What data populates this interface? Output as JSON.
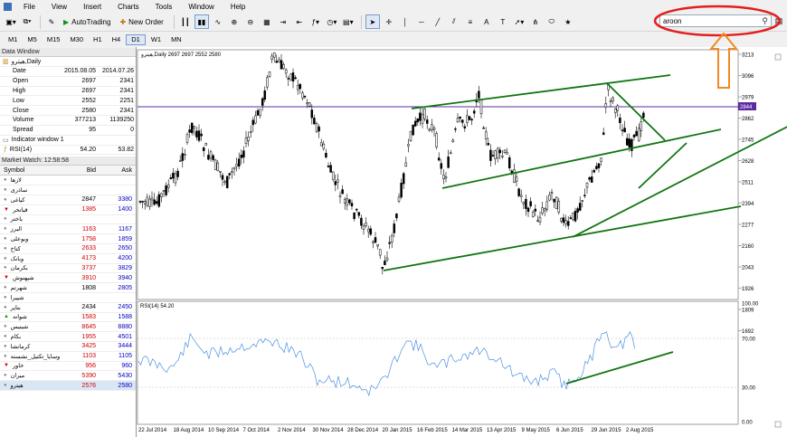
{
  "menu": [
    "File",
    "View",
    "Insert",
    "Charts",
    "Tools",
    "Window",
    "Help"
  ],
  "toolbar": {
    "autotrading": "AutoTrading",
    "neworder": "New Order"
  },
  "search": {
    "value": "aroon"
  },
  "timeframes": [
    "M1",
    "M5",
    "M15",
    "M30",
    "H1",
    "H4",
    "D1",
    "W1",
    "MN"
  ],
  "timeframe_selected": "D1",
  "data_window": {
    "title": "Data Window",
    "symbol": "هیترو,Daily",
    "rows": [
      {
        "label": "Date",
        "v1": "2015.08.05",
        "v2": "2014.07.26"
      },
      {
        "label": "Open",
        "v1": "2697",
        "v2": "2341"
      },
      {
        "label": "High",
        "v1": "2697",
        "v2": "2341"
      },
      {
        "label": "Low",
        "v1": "2552",
        "v2": "2251"
      },
      {
        "label": "Close",
        "v1": "2580",
        "v2": "2341"
      },
      {
        "label": "Volume",
        "v1": "377213",
        "v2": "1139250"
      },
      {
        "label": "Spread",
        "v1": "95",
        "v2": "0"
      }
    ],
    "indicator_window": "Indicator window 1",
    "indicator_row": {
      "label": "RSI(14)",
      "v1": "54.20",
      "v2": "53.82"
    }
  },
  "market_watch": {
    "title": "Market Watch: 12:58:58",
    "headers": {
      "symbol": "Symbol",
      "bid": "Bid",
      "ask": "Ask"
    },
    "rows": [
      {
        "symbol": "لازها",
        "bid": "",
        "ask": "",
        "up": null
      },
      {
        "symbol": "ساذری",
        "bid": "",
        "ask": "",
        "up": null
      },
      {
        "symbol": "کیاغی",
        "bid": "2847",
        "ask": "3380",
        "up": null
      },
      {
        "symbol": "قیاتحر",
        "bid": "1385",
        "ask": "1400",
        "up": false
      },
      {
        "symbol": "باختر",
        "bid": "",
        "ask": "",
        "up": null
      },
      {
        "symbol": "البرز",
        "bid": "1163",
        "ask": "1167",
        "up": null
      },
      {
        "symbol": "وبوعلی",
        "bid": "1758",
        "ask": "1859",
        "up": null
      },
      {
        "symbol": "کتاخ",
        "bid": "2633",
        "ask": "2650",
        "up": null
      },
      {
        "symbol": "وبانک",
        "bid": "4173",
        "ask": "4200",
        "up": null
      },
      {
        "symbol": "بکرمان",
        "bid": "3737",
        "ask": "3829",
        "up": null
      },
      {
        "symbol": "شپهنوش",
        "bid": "3910",
        "ask": "3940",
        "up": false
      },
      {
        "symbol": "شهرتم",
        "bid": "1808",
        "ask": "2805",
        "up": null
      },
      {
        "symbol": "شپیرا",
        "bid": "",
        "ask": "",
        "up": null
      },
      {
        "symbol": "بتاپر",
        "bid": "2434",
        "ask": "2450",
        "up": null
      },
      {
        "symbol": "شوانه",
        "bid": "1583",
        "ask": "1588",
        "up": true
      },
      {
        "symbol": "شینیس",
        "bid": "8645",
        "ask": "8880",
        "up": null
      },
      {
        "symbol": "بکام",
        "bid": "1955",
        "ask": "4501",
        "up": null
      },
      {
        "symbol": "کرمانشا",
        "bid": "3425",
        "ask": "3444",
        "up": null
      },
      {
        "symbol": "وسایا_تکتیل_نشسته",
        "bid": "1103",
        "ask": "1105",
        "up": null
      },
      {
        "symbol": "خاور",
        "bid": "956",
        "ask": "960",
        "up": false
      },
      {
        "symbol": "میران",
        "bid": "5390",
        "ask": "5430",
        "up": null
      },
      {
        "symbol": "هیترو",
        "bid": "2576",
        "ask": "2580",
        "up": null
      }
    ]
  },
  "chart": {
    "header": "هیترو,Daily  2697 2697 2552 2580",
    "price_labels": [
      "3213",
      "3096",
      "2979",
      "2862",
      "2745",
      "2628",
      "2511",
      "2394",
      "2277",
      "2160",
      "2043",
      "1926",
      "1809",
      "1692"
    ],
    "current_price": "2844",
    "rsi_header": "RSI(14) 54.20",
    "rsi_labels": [
      "100.00",
      "70.00",
      "30.00",
      "0.00"
    ],
    "date_labels": [
      "22 Jul 2014",
      "18 Aug 2014",
      "10 Sep 2014",
      "7 Oct 2014",
      "2 Nov 2014",
      "30 Nov 2014",
      "28 Dec 2014",
      "20 Jan 2015",
      "16 Feb 2015",
      "14 Mar 2015",
      "13 Apr 2015",
      "9 May 2015",
      "6 Jun 2015",
      "29 Jun 2015",
      "2 Aug 2015"
    ],
    "colors": {
      "trend": "#127512",
      "hline": "#5b2ca0",
      "annot": "#e41e1e",
      "arrow": "#f08a22"
    }
  }
}
